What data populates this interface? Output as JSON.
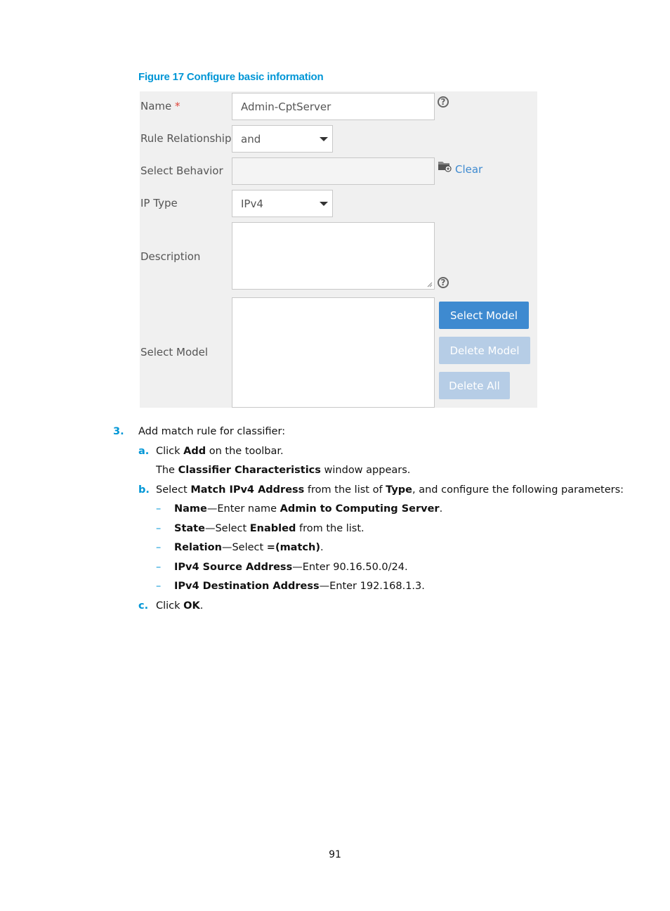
{
  "figure": {
    "caption": "Figure 17 Configure basic information"
  },
  "form": {
    "name": {
      "label": "Name",
      "required_mark": "*",
      "value": "Admin-CptServer",
      "help": "?"
    },
    "rule_relationship": {
      "label": "Rule Relationship",
      "value": "and"
    },
    "select_behavior": {
      "label": "Select Behavior",
      "value": "",
      "clear_label": "Clear"
    },
    "ip_type": {
      "label": "IP Type",
      "value": "IPv4"
    },
    "description": {
      "label": "Description",
      "value": "",
      "help": "?"
    },
    "select_model": {
      "label": "Select Model",
      "select_button": "Select Model",
      "delete_button": "Delete Model",
      "delete_all_button": "Delete All"
    }
  },
  "steps": {
    "step3": {
      "num": "3.",
      "text": "Add match rule for classifier:"
    },
    "a": {
      "num": "a.",
      "pre": "Click ",
      "bold": "Add",
      "post": " on the toolbar."
    },
    "a_note": {
      "pre": "The ",
      "bold": "Classifier Characteristics",
      "post": " window appears."
    },
    "b": {
      "num": "b.",
      "p1": "Select ",
      "b1": "Match IPv4 Address",
      "p2": " from the list of ",
      "b2": "Type",
      "p3": ", and configure the following parameters:"
    },
    "params": [
      {
        "dash": "–",
        "bold": "Name",
        "text": "—Enter name ",
        "bold2": "Admin to Computing Server",
        "end": "."
      },
      {
        "dash": "–",
        "bold": "State",
        "text": "—Select ",
        "bold2": "Enabled",
        "end": " from the list."
      },
      {
        "dash": "–",
        "bold": "Relation",
        "text": "—Select ",
        "bold2": "=(match)",
        "end": "."
      },
      {
        "dash": "–",
        "bold": "IPv4 Source Address",
        "text": "—Enter 90.16.50.0/24.",
        "bold2": "",
        "end": ""
      },
      {
        "dash": "–",
        "bold": "IPv4 Destination Address",
        "text": "—Enter 192.168.1.3.",
        "bold2": "",
        "end": ""
      }
    ],
    "c": {
      "num": "c.",
      "pre": "Click ",
      "bold": "OK",
      "post": "."
    }
  },
  "page_number": "91"
}
